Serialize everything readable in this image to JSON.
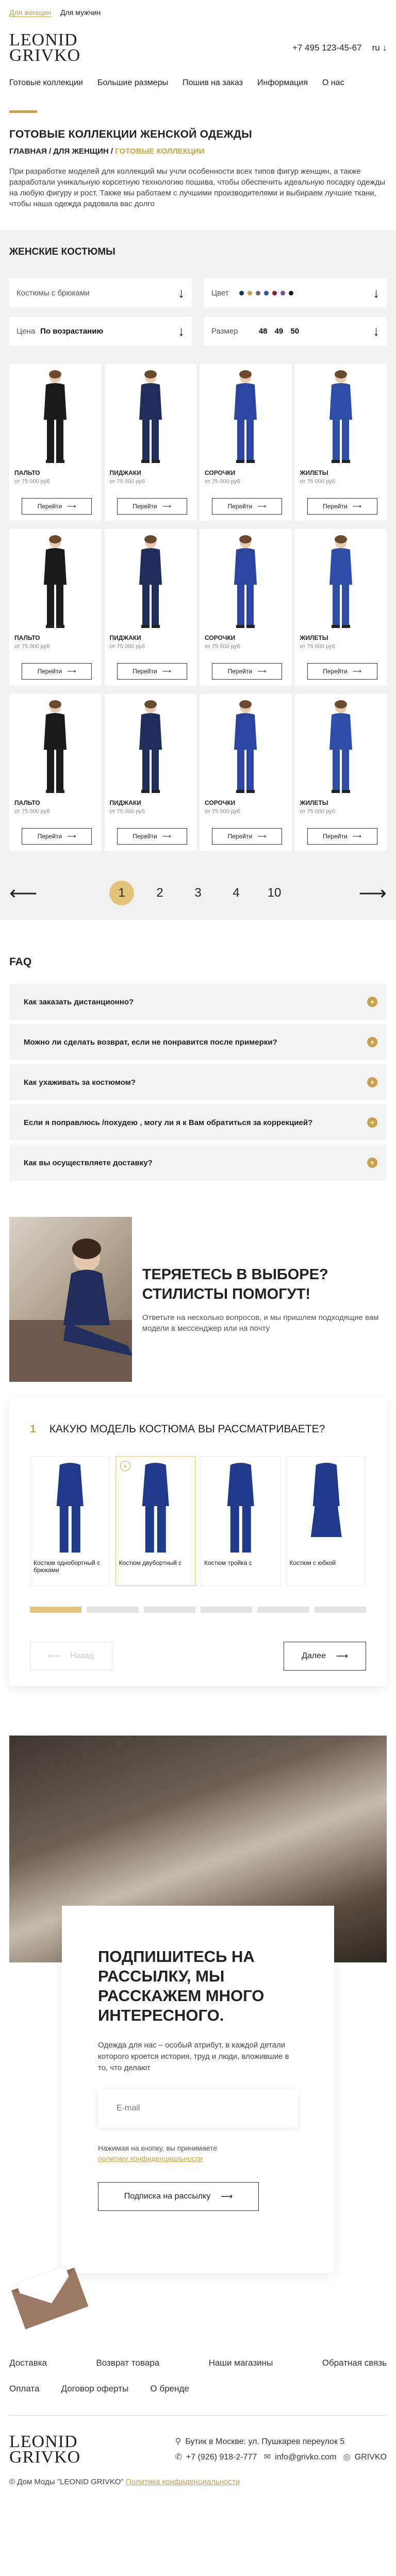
{
  "topbar": {
    "women": "Для женщин",
    "men": "Для мужчин"
  },
  "header": {
    "logo_line1": "LEONID",
    "logo_line2": "GRIVKO",
    "phone": "+7 495 123-45-67",
    "lang": "ru"
  },
  "nav": [
    "Готовые коллекции",
    "Большие размеры",
    "Пошив на заказ",
    "Информация",
    "О нас"
  ],
  "page": {
    "title": "ГОТОВЫЕ КОЛЛЕКЦИИ ЖЕНСКОЙ ОДЕЖДЫ",
    "crumb_main": "ГЛАВНАЯ",
    "crumb_women": "ДЛЯ ЖЕНЩИН",
    "crumb_current": "ГОТОВЫЕ КОЛЛЕКЦИИ",
    "description": "При разработке моделей для коллекций мы учли особенности всех типов фигур женщин, а также разработали уникальную корсетную технологию пошива, чтобы обеспечить идеальную посадку одежды на любую фигуру и рост. Также мы работаем с лучшими производителями и выбираем лучшие ткани, чтобы наша одежда радовала вас долго"
  },
  "catalog": {
    "title": "ЖЕНСКИЕ КОСТЮМЫ",
    "filter_type": "Костюмы с брюками",
    "filter_color": "Цвет",
    "colors": [
      "#1f2d5a",
      "#c8a24a",
      "#6a6a6a",
      "#2e4ea8",
      "#8b1e2d",
      "#7a4c8a",
      "#1a1a1a"
    ],
    "filter_price": "Цена",
    "price_value": "По возрастанию",
    "filter_size": "Размер",
    "sizes": [
      "48",
      "49",
      "50"
    ],
    "button": "Перейти",
    "products": [
      {
        "title": "ПАЛЬТО",
        "price": "от 75 000 руб"
      },
      {
        "title": "ПИДЖАКИ",
        "price": "от 75 000 руб"
      },
      {
        "title": "СОРОЧКИ",
        "price": "от 75 000 руб"
      },
      {
        "title": "ЖИЛЕТЫ",
        "price": "от 75 000 руб"
      },
      {
        "title": "ПАЛЬТО",
        "price": "от 75 000 руб"
      },
      {
        "title": "ПИДЖАКИ",
        "price": "от 75 000 руб"
      },
      {
        "title": "СОРОЧКИ",
        "price": "от 75 000 руб"
      },
      {
        "title": "ЖИЛЕТЫ",
        "price": "от 75 000 руб"
      },
      {
        "title": "ПАЛЬТО",
        "price": "от 75 000 руб"
      },
      {
        "title": "ПИДЖАКИ",
        "price": "от 75 000 руб"
      },
      {
        "title": "СОРОЧКИ",
        "price": "от 75 000 руб"
      },
      {
        "title": "ЖИЛЕТЫ",
        "price": "от 75 000 руб"
      }
    ]
  },
  "pagination": {
    "pages": [
      "1",
      "2",
      "3",
      "4",
      "10"
    ],
    "current": "1"
  },
  "faq": {
    "title": "FAQ",
    "items": [
      "Как заказать дистанционно?",
      "Можно ли сделать возврат, если не понравится после примерки?",
      "Как ухаживать за костюмом?",
      "Если я поправлюсь /похудею , могу ли я к Вам обратиться за коррекцией?",
      "Как вы осуществляете доставку?"
    ]
  },
  "stylist": {
    "heading": "ТЕРЯЕТЕСЬ В ВЫБОРЕ? СТИЛИСТЫ ПОМОГУТ!",
    "text": "Ответьте на несколько вопросов, и мы пришлем подходящие вам модели в мессенджер или на почту"
  },
  "quiz": {
    "number": "1",
    "question": "КАКУЮ МОДЕЛЬ КОСТЮМА ВЫ РАССМАТРИВАЕТЕ?",
    "models": [
      "Костюм однобортный с брюками",
      "Костюм двубортный с",
      "Костюм тройка с",
      "Костюм с юбкой"
    ],
    "back": "Назад",
    "next": "Далее"
  },
  "newsletter": {
    "heading": "ПОДПИШИТЕСЬ НА РАССЫЛКУ, МЫ РАССКАЖЕМ МНОГО ИНТЕРЕСНОГО.",
    "text": "Одежда для нас – особый атрибут, в каждой детали которого кроется история, труд и люди, вложившие в то, что делают",
    "email_placeholder": "E-mail",
    "agree_text": "Нажимая на кнопку, вы принимаете",
    "agree_link": "политику конфиденциальности",
    "button": "Подписка на рассылку"
  },
  "footer": {
    "row1": [
      "Доставка",
      "Возврат товара",
      "Наши магазины",
      "Обратная связь"
    ],
    "row2": [
      "Оплата",
      "Договор оферты",
      "О бренде"
    ],
    "address": "Бутик в Москве: ул. Пушкарев переулок 5",
    "phone": "+7 (926) 918-2-777",
    "email": "info@grivko.com",
    "insta": "GRIVKO",
    "copyright": "© Дом Моды \"LEONID GRIVKO\"",
    "privacy": "Политика конфиденциальности"
  }
}
